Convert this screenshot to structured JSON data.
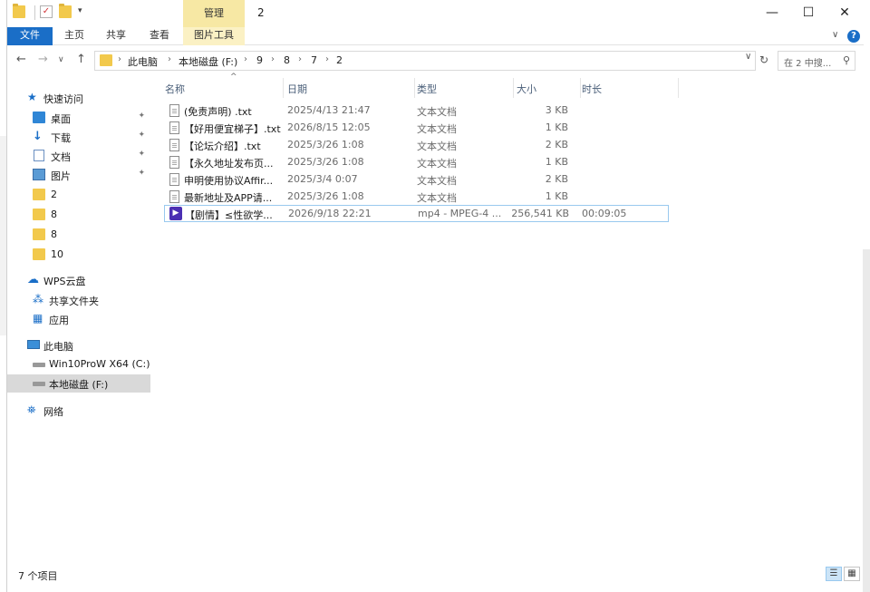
{
  "window": {
    "title": "2",
    "manage_tab": "管理",
    "minimize_glyph": "—",
    "maximize_glyph": "☐",
    "close_glyph": "✕"
  },
  "ribbon": {
    "tabs": [
      "文件",
      "主页",
      "共享",
      "查看",
      "图片工具"
    ],
    "expand_glyph": "∨",
    "help_glyph": "?"
  },
  "address": {
    "back_glyph": "←",
    "forward_glyph": "→",
    "recent_glyph": "∨",
    "up_glyph": "↑",
    "crumbs": [
      "此电脑",
      "本地磁盘 (F:)",
      "9",
      "8",
      "7",
      "2"
    ],
    "separator": "›",
    "dropdown_glyph": "∨",
    "refresh_glyph": "↻",
    "search_placeholder": "在 2 中搜...",
    "search_glyph": "⚲"
  },
  "nav": {
    "quick_access": "快速访问",
    "items": [
      {
        "label": "桌面",
        "icon": "desktop-icon",
        "pinned": true
      },
      {
        "label": "下载",
        "icon": "download-icon",
        "pinned": true
      },
      {
        "label": "文档",
        "icon": "document-icon",
        "pinned": true
      },
      {
        "label": "图片",
        "icon": "picture-icon",
        "pinned": true
      },
      {
        "label": "2",
        "icon": "folder-icon"
      },
      {
        "label": "8",
        "icon": "folder-icon"
      },
      {
        "label": "8",
        "icon": "folder-icon"
      },
      {
        "label": "10",
        "icon": "folder-icon"
      }
    ],
    "pin_glyph": "📌",
    "wps": "WPS云盘",
    "shared": "共享文件夹",
    "apps": "应用",
    "this_pc": "此电脑",
    "drive_c": "Win10ProW X64 (C:)",
    "drive_f": "本地磁盘 (F:)",
    "network": "网络"
  },
  "list": {
    "columns": [
      "名称",
      "日期",
      "类型",
      "大小",
      "时长"
    ],
    "sort_glyph": "^",
    "rows": [
      {
        "name": "(免责声明) .txt",
        "date": "2025/4/13 21:47",
        "type": "文本文档",
        "size": "3 KB",
        "duration": "",
        "kind": "text"
      },
      {
        "name": "【好用便宜梯子】.txt",
        "date": "2026/8/15 12:05",
        "type": "文本文档",
        "size": "1 KB",
        "duration": "",
        "kind": "text"
      },
      {
        "name": "【论坛介绍】.txt",
        "date": "2025/3/26 1:08",
        "type": "文本文档",
        "size": "2 KB",
        "duration": "",
        "kind": "text"
      },
      {
        "name": "【永久地址发布页...",
        "date": "2025/3/26 1:08",
        "type": "文本文档",
        "size": "1 KB",
        "duration": "",
        "kind": "text"
      },
      {
        "name": "申明使用协议Affir...",
        "date": "2025/3/4 0:07",
        "type": "文本文档",
        "size": "2 KB",
        "duration": "",
        "kind": "text"
      },
      {
        "name": "最新地址及APP请...",
        "date": "2025/3/26 1:08",
        "type": "文本文档",
        "size": "1 KB",
        "duration": "",
        "kind": "text"
      },
      {
        "name": "【剧情】≤性欲学...",
        "date": "2026/9/18 22:21",
        "type": "mp4 - MPEG-4 ...",
        "size": "256,541 KB",
        "duration": "00:09:05",
        "kind": "video"
      }
    ]
  },
  "status": {
    "count": "7 个项目",
    "details_glyph": "☰",
    "tiles_glyph": "▦"
  }
}
